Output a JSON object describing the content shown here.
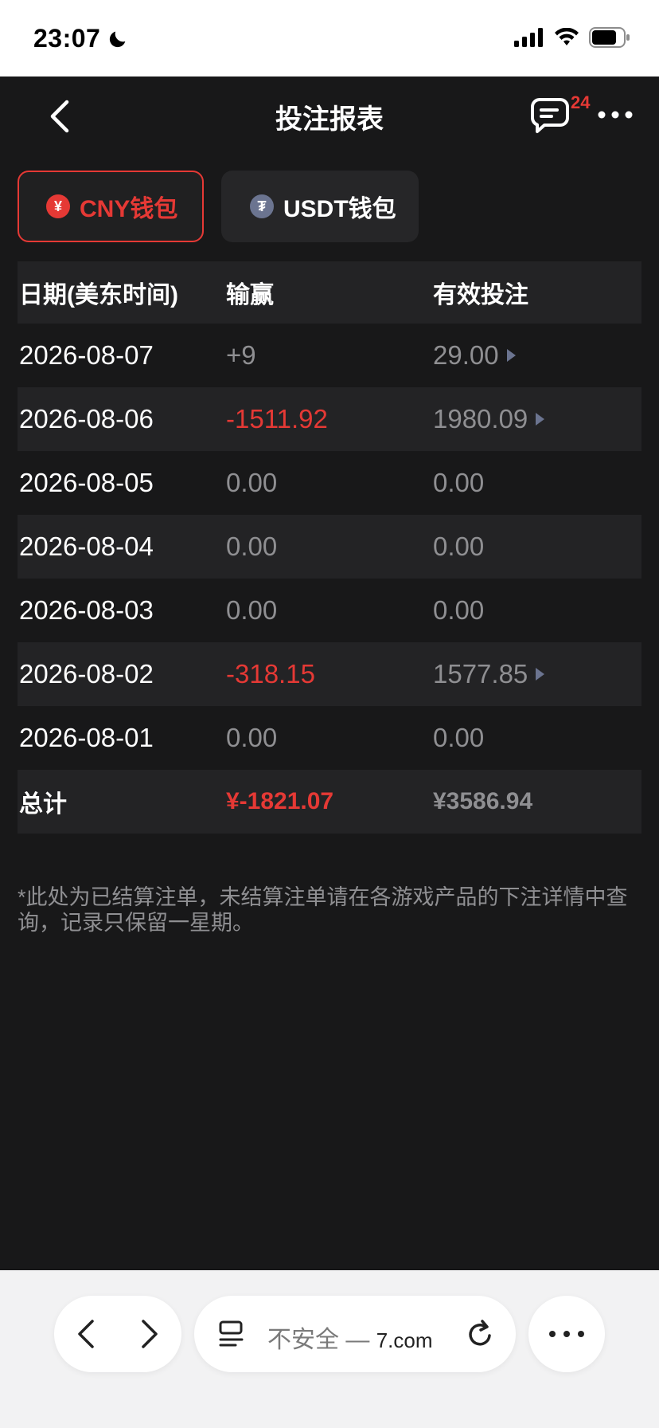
{
  "status_bar": {
    "time": "23:07"
  },
  "nav": {
    "title": "投注报表",
    "message_badge": "24"
  },
  "wallet_tabs": [
    {
      "label": "CNY钱包",
      "coin_symbol": "¥"
    },
    {
      "label": "USDT钱包",
      "coin_symbol": "₮"
    }
  ],
  "table": {
    "headers": [
      "日期(美东时间)",
      "输赢",
      "有效投注"
    ],
    "rows": [
      {
        "date": "2026-08-07",
        "win_loss": "+9",
        "valid_bet": "29.00"
      },
      {
        "date": "2026-08-06",
        "win_loss": "-1511.92",
        "valid_bet": "1980.09"
      },
      {
        "date": "2026-08-05",
        "win_loss": "0.00",
        "valid_bet": "0.00"
      },
      {
        "date": "2026-08-04",
        "win_loss": "0.00",
        "valid_bet": "0.00"
      },
      {
        "date": "2026-08-03",
        "win_loss": "0.00",
        "valid_bet": "0.00"
      },
      {
        "date": "2026-08-02",
        "win_loss": "-318.15",
        "valid_bet": "1577.85"
      },
      {
        "date": "2026-08-01",
        "win_loss": "0.00",
        "valid_bet": "0.00"
      }
    ],
    "total": {
      "label": "总计",
      "win_loss": "¥-1821.07",
      "valid_bet": "¥3586.94"
    }
  },
  "note": "*此处为已结算注单，未结算注单请在各游戏产品的下注详情中查询，记录只保留一星期。",
  "browser": {
    "security_label": "不安全 —",
    "domain": "7.com"
  },
  "colors": {
    "accent": "#e53935",
    "background": "#181819",
    "row_alt": "#232325"
  }
}
